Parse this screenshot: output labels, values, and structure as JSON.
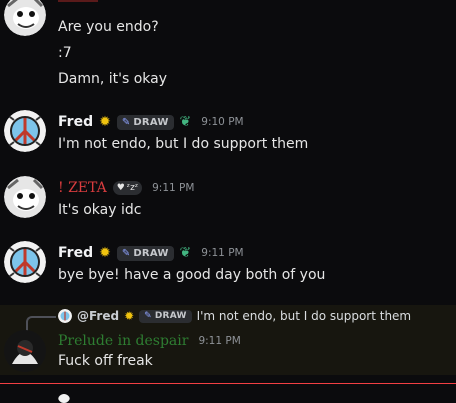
{
  "messages": [
    {
      "lines": [
        "Are you endo?",
        ":7",
        "Damn, it's okay"
      ],
      "color": "#d83c3e"
    },
    {
      "username": "Fred",
      "username_color": "#f2f3f5",
      "badge": "DRAW",
      "time": "9:10 PM",
      "text": "I'm not endo, but I do support them"
    },
    {
      "username": "! ZETA",
      "username_color": "#d83c3e",
      "heart_badge": "ᶻzᶻ",
      "time": "9:11 PM",
      "text": "It's okay idc"
    },
    {
      "username": "Fred",
      "username_color": "#f2f3f5",
      "badge": "DRAW",
      "time": "9:11 PM",
      "text": "bye bye!  have a good day both of you"
    },
    {
      "reply": {
        "username": "@Fred",
        "badge": "DRAW",
        "text": "I'm not endo, but I do support them"
      },
      "username": "Prelude in despair",
      "username_color": "#2e7d32",
      "time": "9:11 PM",
      "text": "Fuck off freak"
    }
  ],
  "colors": {
    "background": "#0b0b0d",
    "highlight": "#17160f",
    "new_messages_line": "#f23f43"
  }
}
